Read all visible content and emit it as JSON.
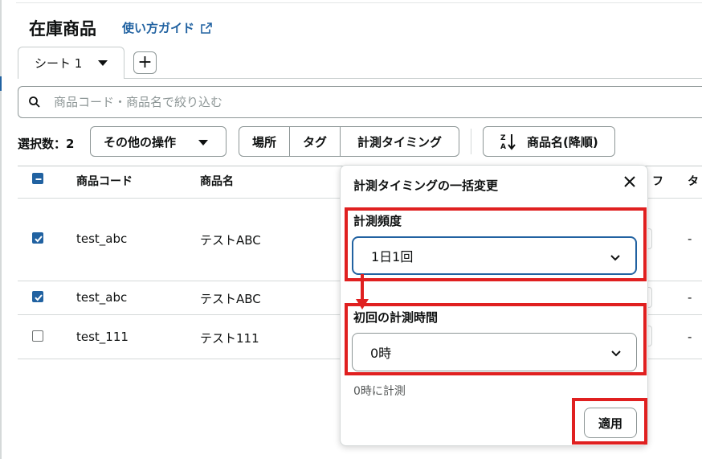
{
  "header": {
    "title": "在庫商品",
    "guide_link": "使い方ガイド"
  },
  "sheet_tab": {
    "label": "シート 1",
    "add_label": "+"
  },
  "search": {
    "placeholder": "商品コード・商品名で絞り込む"
  },
  "toolbar": {
    "selected_count": "選択数：2",
    "other_ops": "その他の操作",
    "segments": [
      "場所",
      "タグ",
      "計測タイミング"
    ],
    "sort_label": "商品名(降順)"
  },
  "table": {
    "columns": [
      "商品コード",
      "商品名"
    ],
    "partial_headers": [
      "フ",
      "タ"
    ],
    "rows": [
      {
        "checked": true,
        "code": "test_abc",
        "name": "テストABC",
        "trailing": "-"
      },
      {
        "checked": true,
        "code": "test_abc",
        "name": "テストABC",
        "trailing": "-"
      },
      {
        "checked": false,
        "code": "test_111",
        "name": "テスト111",
        "trailing": "-"
      }
    ]
  },
  "popover": {
    "title": "計測タイミングの一括変更",
    "frequency_label": "計測頻度",
    "frequency_value": "1日1回",
    "first_time_label": "初回の計測時間",
    "first_time_value": "0時",
    "hint": "0時に計測",
    "apply_label": "適用"
  },
  "colors": {
    "accent": "#2162a1",
    "highlight": "#e02020",
    "text": "#0f1111",
    "border": "#8d9696"
  }
}
